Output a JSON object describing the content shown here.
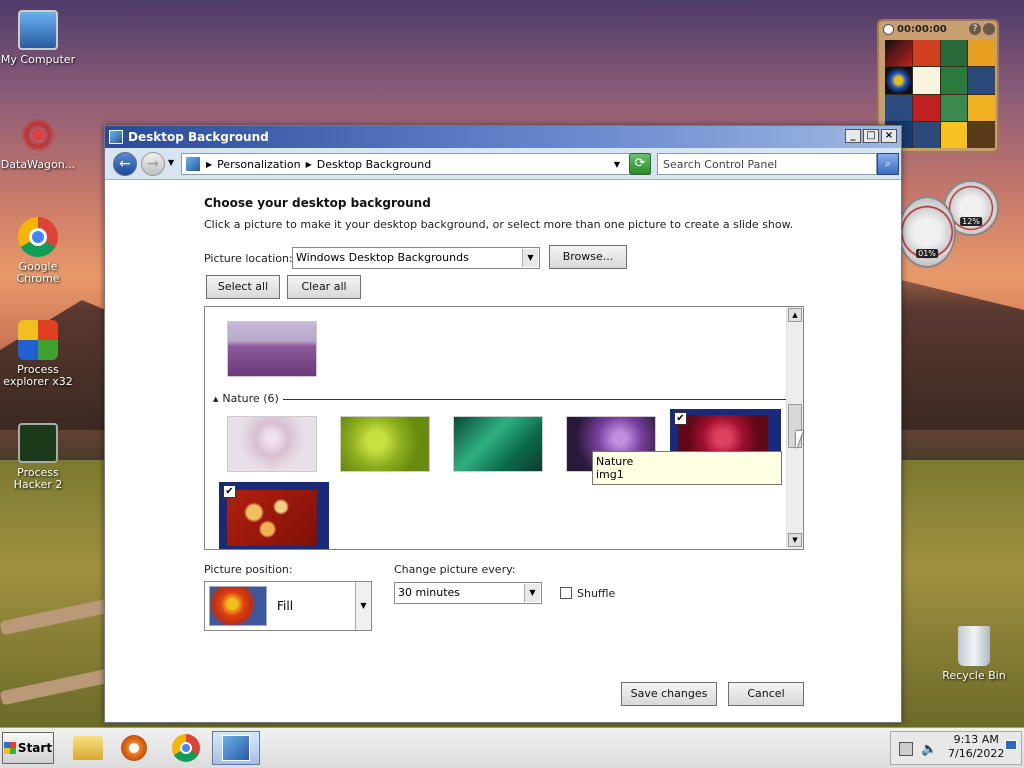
{
  "desktop": {
    "icons": [
      {
        "label": "My Computer"
      },
      {
        "label": "DataWagon..."
      },
      {
        "label": "Google Chrome"
      },
      {
        "label": "Process explorer x32"
      },
      {
        "label": "Process Hacker 2"
      },
      {
        "label": "Recycle Bin"
      }
    ],
    "puzzle_gadget": {
      "timer": "00:00:00"
    },
    "meter_gadget": {
      "cpu": "01%",
      "memory": "12%"
    }
  },
  "window": {
    "title": "Desktop Background",
    "address": {
      "crumb1": "Personalization",
      "crumb2": "Desktop Background"
    },
    "search_placeholder": "Search Control Panel",
    "heading": "Choose your desktop background",
    "subheading": "Click a picture to make it your desktop background, or select more than one picture to create a slide show.",
    "picture_location_label": "Picture location:",
    "picture_location_value": "Windows Desktop Backgrounds",
    "browse_label": "Browse...",
    "select_all_label": "Select all",
    "clear_all_label": "Clear all",
    "group_name": "Nature (6)",
    "tooltip": {
      "line1": "Nature",
      "line2": "img1"
    },
    "picture_position_label": "Picture position:",
    "picture_position_value": "Fill",
    "change_every_label": "Change picture every:",
    "change_every_value": "30 minutes",
    "shuffle_label": "Shuffle",
    "save_label": "Save changes",
    "cancel_label": "Cancel"
  },
  "taskbar": {
    "start_label": "Start",
    "time": "9:13 AM",
    "date": "7/16/2022"
  }
}
